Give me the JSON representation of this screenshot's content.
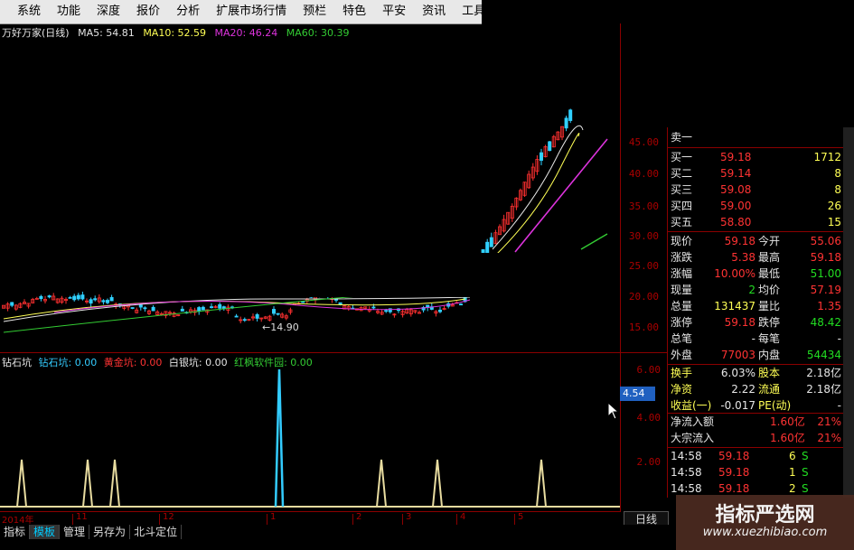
{
  "menu": {
    "items": [
      "系统",
      "功能",
      "深度",
      "报价",
      "分析",
      "扩展市场行情",
      "预栏",
      "特色",
      "平安",
      "资讯",
      "工具"
    ]
  },
  "kline": {
    "title": "万好万家(日线)",
    "ma": [
      {
        "label": "MA5: 54.81",
        "color": "#e6e6e6"
      },
      {
        "label": "MA10: 52.59",
        "color": "#ffff55"
      },
      {
        "label": "MA20: 46.24",
        "color": "#dd33dd"
      },
      {
        "label": "MA60: 30.39",
        "color": "#33cc33"
      }
    ],
    "low_label": "←14.90",
    "axis_ticks": [
      "45.00",
      "40.00",
      "35.00",
      "30.00",
      "25.00",
      "20.00",
      "15.00"
    ]
  },
  "indicator": {
    "items": [
      {
        "label": "钻石坑",
        "color": "#e6e6e6"
      },
      {
        "label": "钻石坑: 0.00",
        "color": "#33ccff"
      },
      {
        "label": "黄金坑: 0.00",
        "color": "#ff3333"
      },
      {
        "label": "白银坑: 0.00",
        "color": "#e6e6e6"
      },
      {
        "label": "红枫软件园: 0.00",
        "color": "#33cc33"
      }
    ],
    "axis_ticks": [
      "6.00",
      "4.00",
      "2.00"
    ],
    "current_value": "4.54"
  },
  "dates": [
    "2014年",
    "11",
    "12",
    "1",
    "2",
    "3",
    "4",
    "5"
  ],
  "bottom_tabs": [
    "指标",
    "模板",
    "管理",
    "另存为",
    "北斗定位"
  ],
  "period_tab": "日线",
  "quote": {
    "sell_top": "卖一",
    "buy": [
      {
        "label": "买一",
        "price": "59.18",
        "vol": "1712"
      },
      {
        "label": "买二",
        "price": "59.14",
        "vol": "8"
      },
      {
        "label": "买三",
        "price": "59.08",
        "vol": "8"
      },
      {
        "label": "买四",
        "price": "59.00",
        "vol": "26"
      },
      {
        "label": "买五",
        "price": "58.80",
        "vol": "15"
      }
    ],
    "stats": [
      {
        "l1": "现价",
        "v1": "59.18",
        "c1": "red",
        "l2": "今开",
        "v2": "55.06",
        "c2": "red"
      },
      {
        "l1": "涨跌",
        "v1": "5.38",
        "c1": "red",
        "l2": "最高",
        "v2": "59.18",
        "c2": "red"
      },
      {
        "l1": "涨幅",
        "v1": "10.00%",
        "c1": "red",
        "l2": "最低",
        "v2": "51.00",
        "c2": "green"
      },
      {
        "l1": "现量",
        "v1": "2",
        "c1": "green",
        "l2": "均价",
        "v2": "57.19",
        "c2": "red"
      },
      {
        "l1": "总量",
        "v1": "131437",
        "c1": "yel",
        "l2": "量比",
        "v2": "1.35",
        "c2": "red"
      },
      {
        "l1": "涨停",
        "v1": "59.18",
        "c1": "red",
        "l2": "跌停",
        "v2": "48.42",
        "c2": "green"
      },
      {
        "l1": "总笔",
        "v1": "-",
        "c1": "white",
        "l2": "每笔",
        "v2": "-",
        "c2": "white"
      },
      {
        "l1": "外盘",
        "v1": "77003",
        "c1": "red",
        "l2": "内盘",
        "v2": "54434",
        "c2": "green"
      }
    ],
    "fin": [
      {
        "l1": "换手",
        "v1": "6.03%",
        "l2": "股本",
        "v2": "2.18亿"
      },
      {
        "l1": "净资",
        "v1": "2.22",
        "l2": "流通",
        "v2": "2.18亿"
      },
      {
        "l1": "收益(一)",
        "v1": "-0.017",
        "l2": "PE(动)",
        "v2": "-"
      }
    ],
    "flow": [
      {
        "label": "净流入额",
        "value": "1.60亿",
        "pct": "21%"
      },
      {
        "label": "大宗流入",
        "value": "1.60亿",
        "pct": "21%"
      }
    ],
    "ticks": [
      {
        "time": "14:58",
        "price": "59.18",
        "vol": "6",
        "side": "S"
      },
      {
        "time": "14:58",
        "price": "59.18",
        "vol": "1",
        "side": "S"
      },
      {
        "time": "14:58",
        "price": "59.18",
        "vol": "2",
        "side": "S"
      }
    ]
  },
  "watermark": {
    "title": "指标严选网",
    "url": "www.xuezhibiao.com"
  }
}
